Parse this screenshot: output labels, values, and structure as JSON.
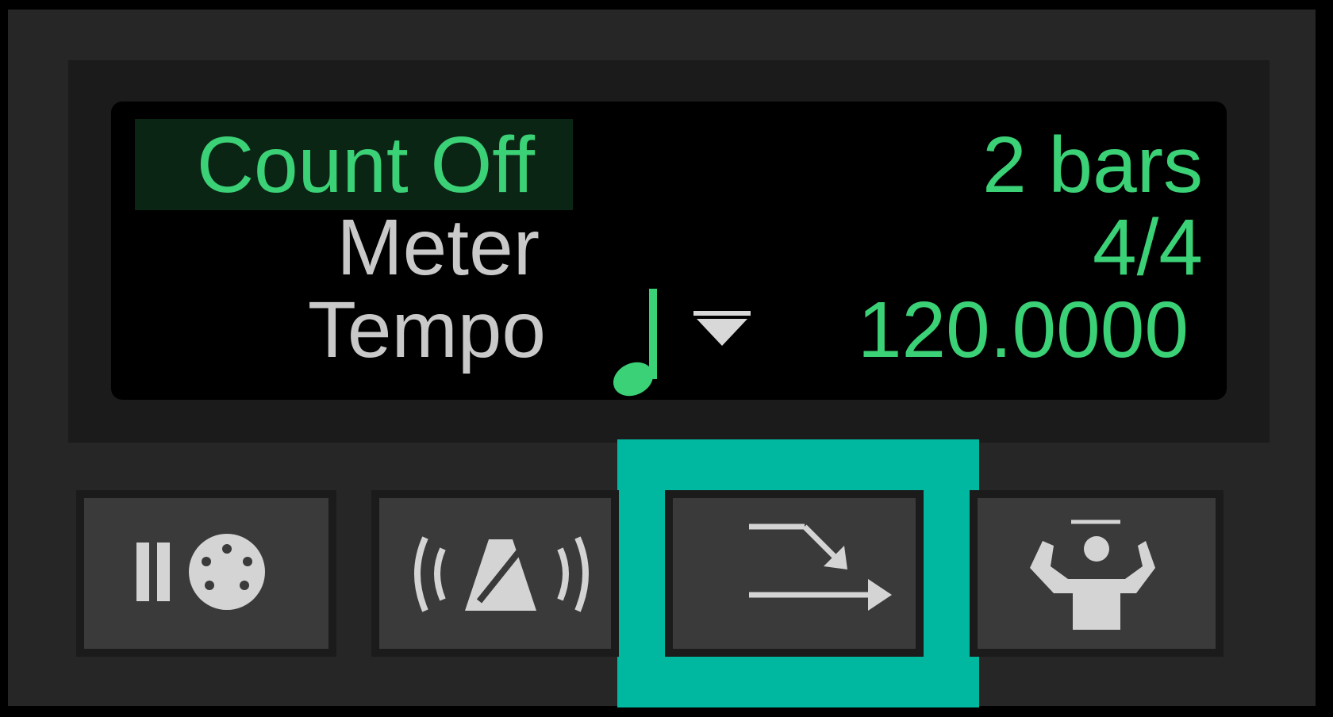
{
  "count_off": {
    "label": "Count Off",
    "value": "2 bars"
  },
  "meter": {
    "label": "Meter",
    "value": "4/4"
  },
  "tempo": {
    "label": "Tempo",
    "value": "120.0000",
    "note_icon": "quarter-note-icon",
    "menu_icon": "dropdown-triangle-icon"
  },
  "buttons": [
    {
      "name": "midi-pause-button",
      "icon": "pause-midi-icon"
    },
    {
      "name": "metronome-button",
      "icon": "metronome-icon"
    },
    {
      "name": "wait-for-note-button",
      "icon": "wait-arrow-icon",
      "highlighted": true
    },
    {
      "name": "conductor-button",
      "icon": "conductor-icon"
    }
  ],
  "colors": {
    "accent_green": "#3bd176",
    "label_gray": "#c9c9c9",
    "highlight_teal": "#00b89f"
  }
}
